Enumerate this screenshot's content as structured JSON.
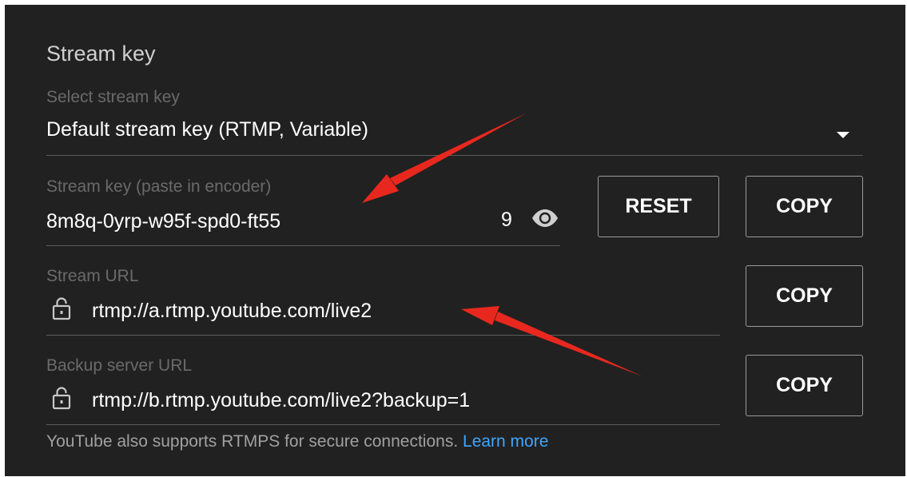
{
  "section": {
    "title": "Stream key"
  },
  "select_key": {
    "label": "Select stream key",
    "value": "Default stream key (RTMP, Variable)",
    "icon": "dropdown-arrow-icon"
  },
  "stream_key": {
    "label": "Stream key (paste in encoder)",
    "value": "8m8q-0yrp-w95f-spd0-ft55",
    "count": "9",
    "visibility_icon": "eye-icon",
    "reset_label": "RESET",
    "copy_label": "COPY"
  },
  "stream_url": {
    "label": "Stream URL",
    "value": "rtmp://a.rtmp.youtube.com/live2",
    "lock_icon": "lock-icon",
    "copy_label": "COPY"
  },
  "backup_url": {
    "label": "Backup server URL",
    "value": "rtmp://b.rtmp.youtube.com/live2?backup=1",
    "lock_icon": "lock-icon",
    "copy_label": "COPY"
  },
  "footer": {
    "text": "YouTube also supports RTMPS for secure connections. ",
    "link": "Learn more"
  },
  "colors": {
    "background": "#212121",
    "text": "#ffffff",
    "muted": "#6a6a6a",
    "link": "#3ea6ff",
    "annotation_arrow": "#e8281e"
  }
}
